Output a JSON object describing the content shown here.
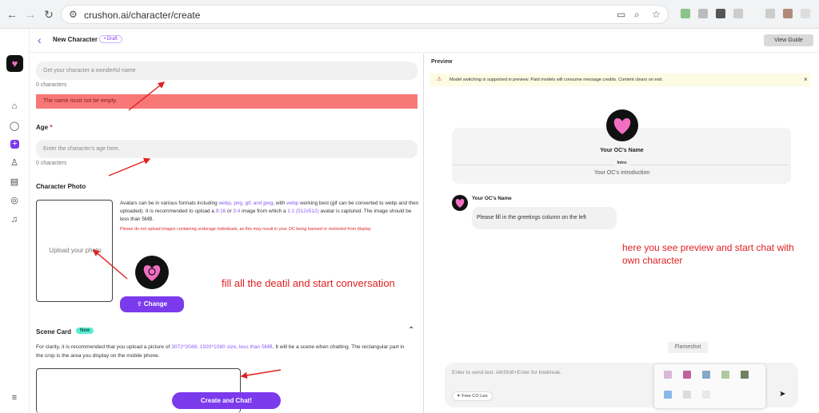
{
  "browser": {
    "url": "crushon.ai/character/create"
  },
  "header": {
    "title": "New Character",
    "badge": "• Draft",
    "guide": "View Guide"
  },
  "form": {
    "name_placeholder": "Get your character a wonderful name",
    "name_count": "0 characters",
    "name_error": "The name must not be empty.",
    "age_label": "Age",
    "age_required": "*",
    "age_placeholder": "Enter the character's age here.",
    "age_count": "0 characters",
    "photo_label": "Character Photo",
    "photo_upload": "Upload your photo",
    "avatar_desc": {
      "p1": "Avatars can be in various formats including ",
      "formats": "webp, png, gif, and jpeg",
      "p2": ", with ",
      "webp": "webp",
      "p3": " working best (gif can be converted to webp and then uploaded). It is recommended to upload a ",
      "r1": "9:16",
      "p4": " or ",
      "r2": "3:4",
      "p5": " image from which a ",
      "r3": "1:1 (512x512)",
      "p6": " avatar is captured. The image should be less than 5MB."
    },
    "avatar_warning": "Please do not upload images containing underage individuals, as this may result in your OC being banned or restricted from display.",
    "change_button": "Change",
    "scene_label": "Scene Card",
    "scene_badge": "New",
    "scene_desc": {
      "p1": "For clarity, it is recommended that you upload a picture of ",
      "sizes": "3072*2048, 1920*1080 size, less than 5MB",
      "p2": ". It will be a scene when chatting. The rectangular part in the crop is the area you display on the mobile phone."
    },
    "create_button": "Create and Chat!",
    "annotation": "fill all the deatil and start conversation"
  },
  "preview": {
    "title": "Preview",
    "notice": "Model switching is supported in preview. Paid models will consume message credits. Content clears on exit.",
    "oc_name": "Your OC's Name",
    "intro_label": "Intro",
    "intro_text": "Your OC's introduction",
    "msg_name": "Your OC's Name",
    "greeting": "Please fill in the greetings column on the left",
    "annotation": "here you see preview and start chat with own character",
    "flameshot": "Flameshot",
    "chat_placeholder": "Enter to send text. Alt/Shift+Enter for linebreak.",
    "model_chip": "Free CO Leo"
  },
  "colors": {
    "accent": "#7c3aed",
    "heart": "#f06fc1",
    "error_bg": "#f87878",
    "annotation": "#e02020"
  }
}
